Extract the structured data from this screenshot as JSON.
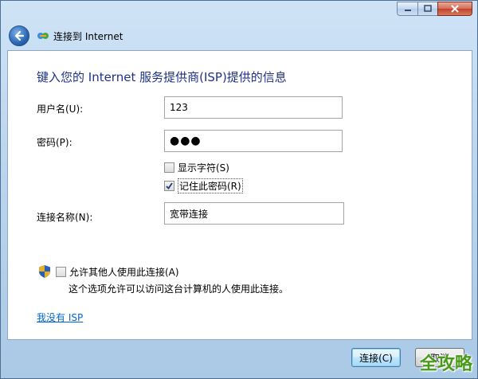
{
  "header": {
    "title": "连接到 Internet"
  },
  "form": {
    "heading": "键入您的 Internet 服务提供商(ISP)提供的信息",
    "username_label": "用户名(U):",
    "username_value": "123",
    "password_label": "密码(P):",
    "password_value": "●●●",
    "show_chars_label": "显示字符(S)",
    "show_chars_checked": false,
    "remember_label": "记住此密码(R)",
    "remember_checked": true,
    "connection_name_label": "连接名称(N):",
    "connection_name_value": "宽带连接"
  },
  "allow_others": {
    "label": "允许其他人使用此连接(A)",
    "checked": false,
    "description": "这个选项允许可以访问这台计算机的人使用此连接。"
  },
  "link": {
    "no_isp": "我没有 ISP"
  },
  "footer": {
    "connect_label": "连接(C)",
    "cancel_label": "取消"
  },
  "watermark": "全攻略",
  "colors": {
    "heading": "#1e3287",
    "link": "#0066cc",
    "watermark": "#4a9a1a"
  }
}
